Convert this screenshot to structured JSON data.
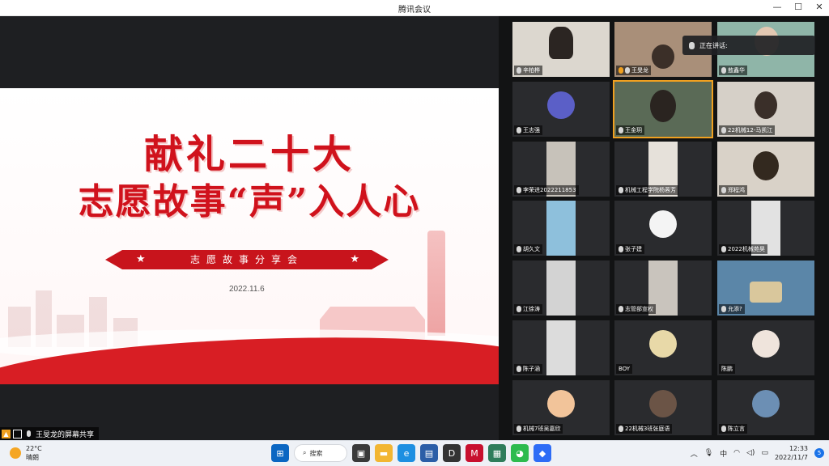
{
  "window": {
    "title": "腾讯会议",
    "minimize": "—",
    "maximize": "☐",
    "close": "✕"
  },
  "slide": {
    "line1": "献礼二十大",
    "line2": "志愿故事“声”入人心",
    "ribbon": "志愿故事分享会",
    "date": "2022.11.6"
  },
  "share_tag": "王旻龙的屏幕共享",
  "speaking_label": "正在讲话:",
  "participants": [
    {
      "name": "辛柏桦"
    },
    {
      "name": "王旻龙"
    },
    {
      "name": "敖鑫华"
    },
    {
      "name": "王志强"
    },
    {
      "name": "王金玥"
    },
    {
      "name": "22机械12-马凯江"
    },
    {
      "name": "李荣进2022211853"
    },
    {
      "name": "机械工程学院杨蓉芳"
    },
    {
      "name": "郑程鸿"
    },
    {
      "name": "胡久文"
    },
    {
      "name": "张子建"
    },
    {
      "name": "2022机械苑昊"
    },
    {
      "name": "江徐涛"
    },
    {
      "name": "志管部宣权"
    },
    {
      "name": "允添?"
    },
    {
      "name": "陈子涵"
    },
    {
      "name": "BOY"
    },
    {
      "name": "陈鹏"
    },
    {
      "name": "机械7班吴嘉欣"
    },
    {
      "name": "22机械3班张庭语"
    },
    {
      "name": "陈立言"
    }
  ],
  "taskbar": {
    "temperature": "22°C",
    "weather": "晴朗",
    "search": "搜索",
    "ime": "中",
    "time": "12:33",
    "date": "2022/11/7",
    "notifications": "5"
  },
  "colors": {
    "accent_red": "#d0121c",
    "meeting_bg": "#1e1f22",
    "speaking_border": "#f0a020"
  }
}
